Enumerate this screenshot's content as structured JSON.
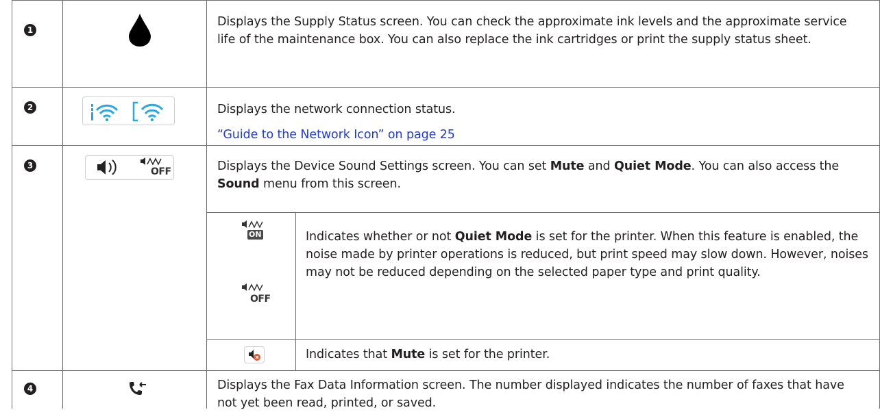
{
  "rows": [
    {
      "num": "1",
      "icon": "ink-drop-icon",
      "desc": "Displays the Supply Status screen. You can check the approximate ink levels and the approximate service life of the maintenance box. You can also replace the ink cartridges or print the supply status sheet."
    },
    {
      "num": "2",
      "icon": "network-status-icons",
      "desc": "Displays the network connection status.",
      "link": "“Guide to the Network Icon” on page 25"
    },
    {
      "num": "3",
      "icon": "sound-settings-icons",
      "desc_a": "Displays the Device Sound Settings screen. You can set ",
      "desc_b": "Mute",
      "desc_c": " and ",
      "desc_d": "Quiet Mode",
      "desc_e": ". You can also access the ",
      "desc_f": "Sound",
      "desc_g": " menu from this screen.",
      "icon_off_label": "OFF",
      "sub": [
        {
          "icon": "quiet-mode-on-off-icons",
          "on_label": "ON",
          "off_label": "OFF",
          "desc_a": "Indicates whether or not ",
          "desc_b": "Quiet Mode",
          "desc_c": " is set for the printer. When this feature is enabled, the noise made by printer operations is reduced, but print speed may slow down. However, noises may not be reduced depending on the selected paper type and print quality."
        },
        {
          "icon": "mute-icon",
          "desc_a": "Indicates that ",
          "desc_b": "Mute",
          "desc_c": " is set for the printer."
        }
      ]
    },
    {
      "num": "4",
      "icon": "fax-data-icon",
      "desc": "Displays the Fax Data Information screen. The number displayed indicates the number of faxes that have not yet been read, printed, or saved."
    }
  ]
}
